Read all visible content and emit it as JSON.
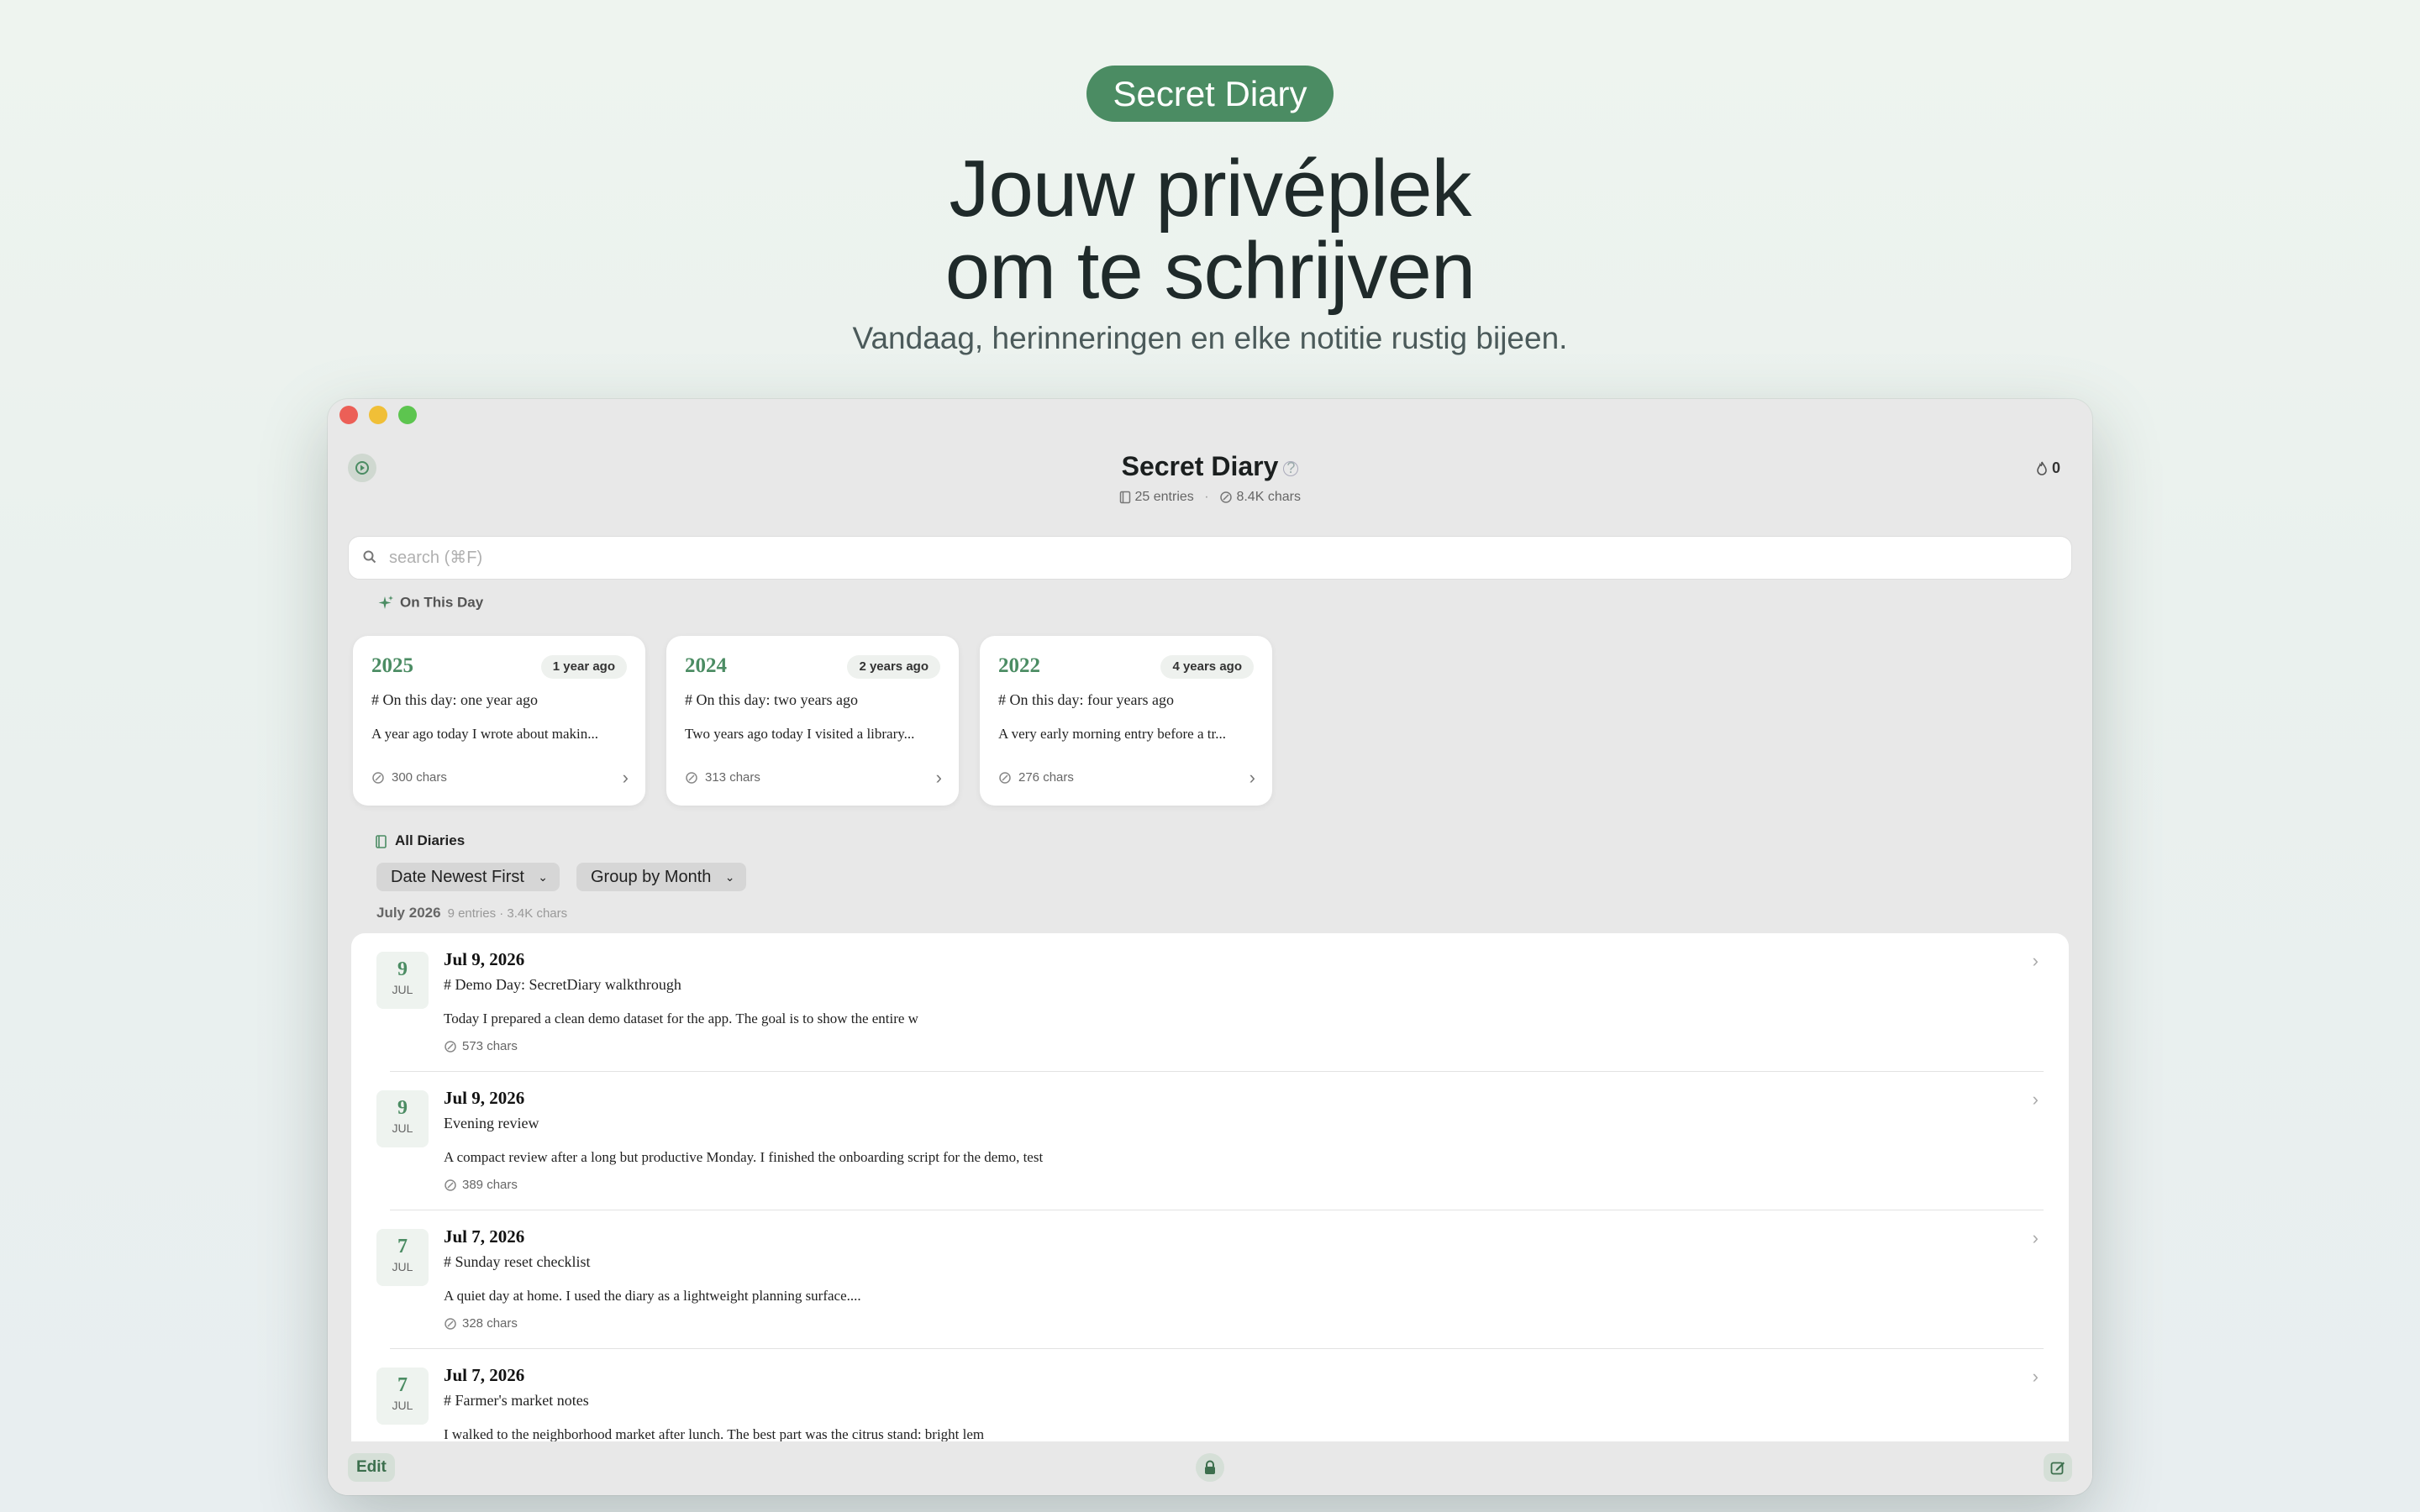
{
  "hero": {
    "badge": "Secret Diary",
    "headline_line1": "Jouw privéplek",
    "headline_line2": "om te schrijven",
    "subtitle": "Vandaag, herinneringen en elke notitie rustig bijeen."
  },
  "app": {
    "title": "Secret Diary",
    "entries_count": "25 entries",
    "chars_count": "8.4K chars",
    "streak": "0",
    "search_placeholder": "search (⌘F)"
  },
  "on_this_day": {
    "label": "On This Day",
    "cards": [
      {
        "year": "2025",
        "ago": "1 year ago",
        "title": "# On this day: one year ago",
        "preview": "A year ago today I wrote about makin...",
        "chars": "300 chars"
      },
      {
        "year": "2024",
        "ago": "2 years ago",
        "title": "# On this day: two years ago",
        "preview": "Two years ago today I visited a library...",
        "chars": "313 chars"
      },
      {
        "year": "2022",
        "ago": "4 years ago",
        "title": "# On this day: four years ago",
        "preview": "A very early morning entry before a tr...",
        "chars": "276 chars"
      }
    ]
  },
  "all_diaries": {
    "label": "All Diaries",
    "sort_option": "Date Newest First",
    "group_option": "Group by Month",
    "group": {
      "month": "July 2026",
      "meta": "9 entries · 3.4K chars"
    },
    "entries": [
      {
        "day": "9",
        "mon": "JUL",
        "date": "Jul 9, 2026",
        "title": "# Demo Day: SecretDiary walkthrough",
        "body": "Today I prepared a clean demo dataset for the app. The goal is to show the entire w",
        "chars": "573 chars"
      },
      {
        "day": "9",
        "mon": "JUL",
        "date": "Jul 9, 2026",
        "title": "Evening review",
        "body": "A compact review after a long but productive Monday. I finished the onboarding script for the demo, test",
        "chars": "389 chars"
      },
      {
        "day": "7",
        "mon": "JUL",
        "date": "Jul 7, 2026",
        "title": "# Sunday reset checklist",
        "body": "A quiet day at home. I used the diary as a lightweight planning surface....",
        "chars": "328 chars"
      },
      {
        "day": "7",
        "mon": "JUL",
        "date": "Jul 7, 2026",
        "title": "# Farmer's market notes",
        "body": "I walked to the neighborhood market after lunch. The best part was the citrus stand: bright lem",
        "chars": ""
      }
    ]
  },
  "bottom": {
    "edit_label": "Edit"
  },
  "colors": {
    "accent": "#4b8c63",
    "background": "#e8e8e8"
  }
}
